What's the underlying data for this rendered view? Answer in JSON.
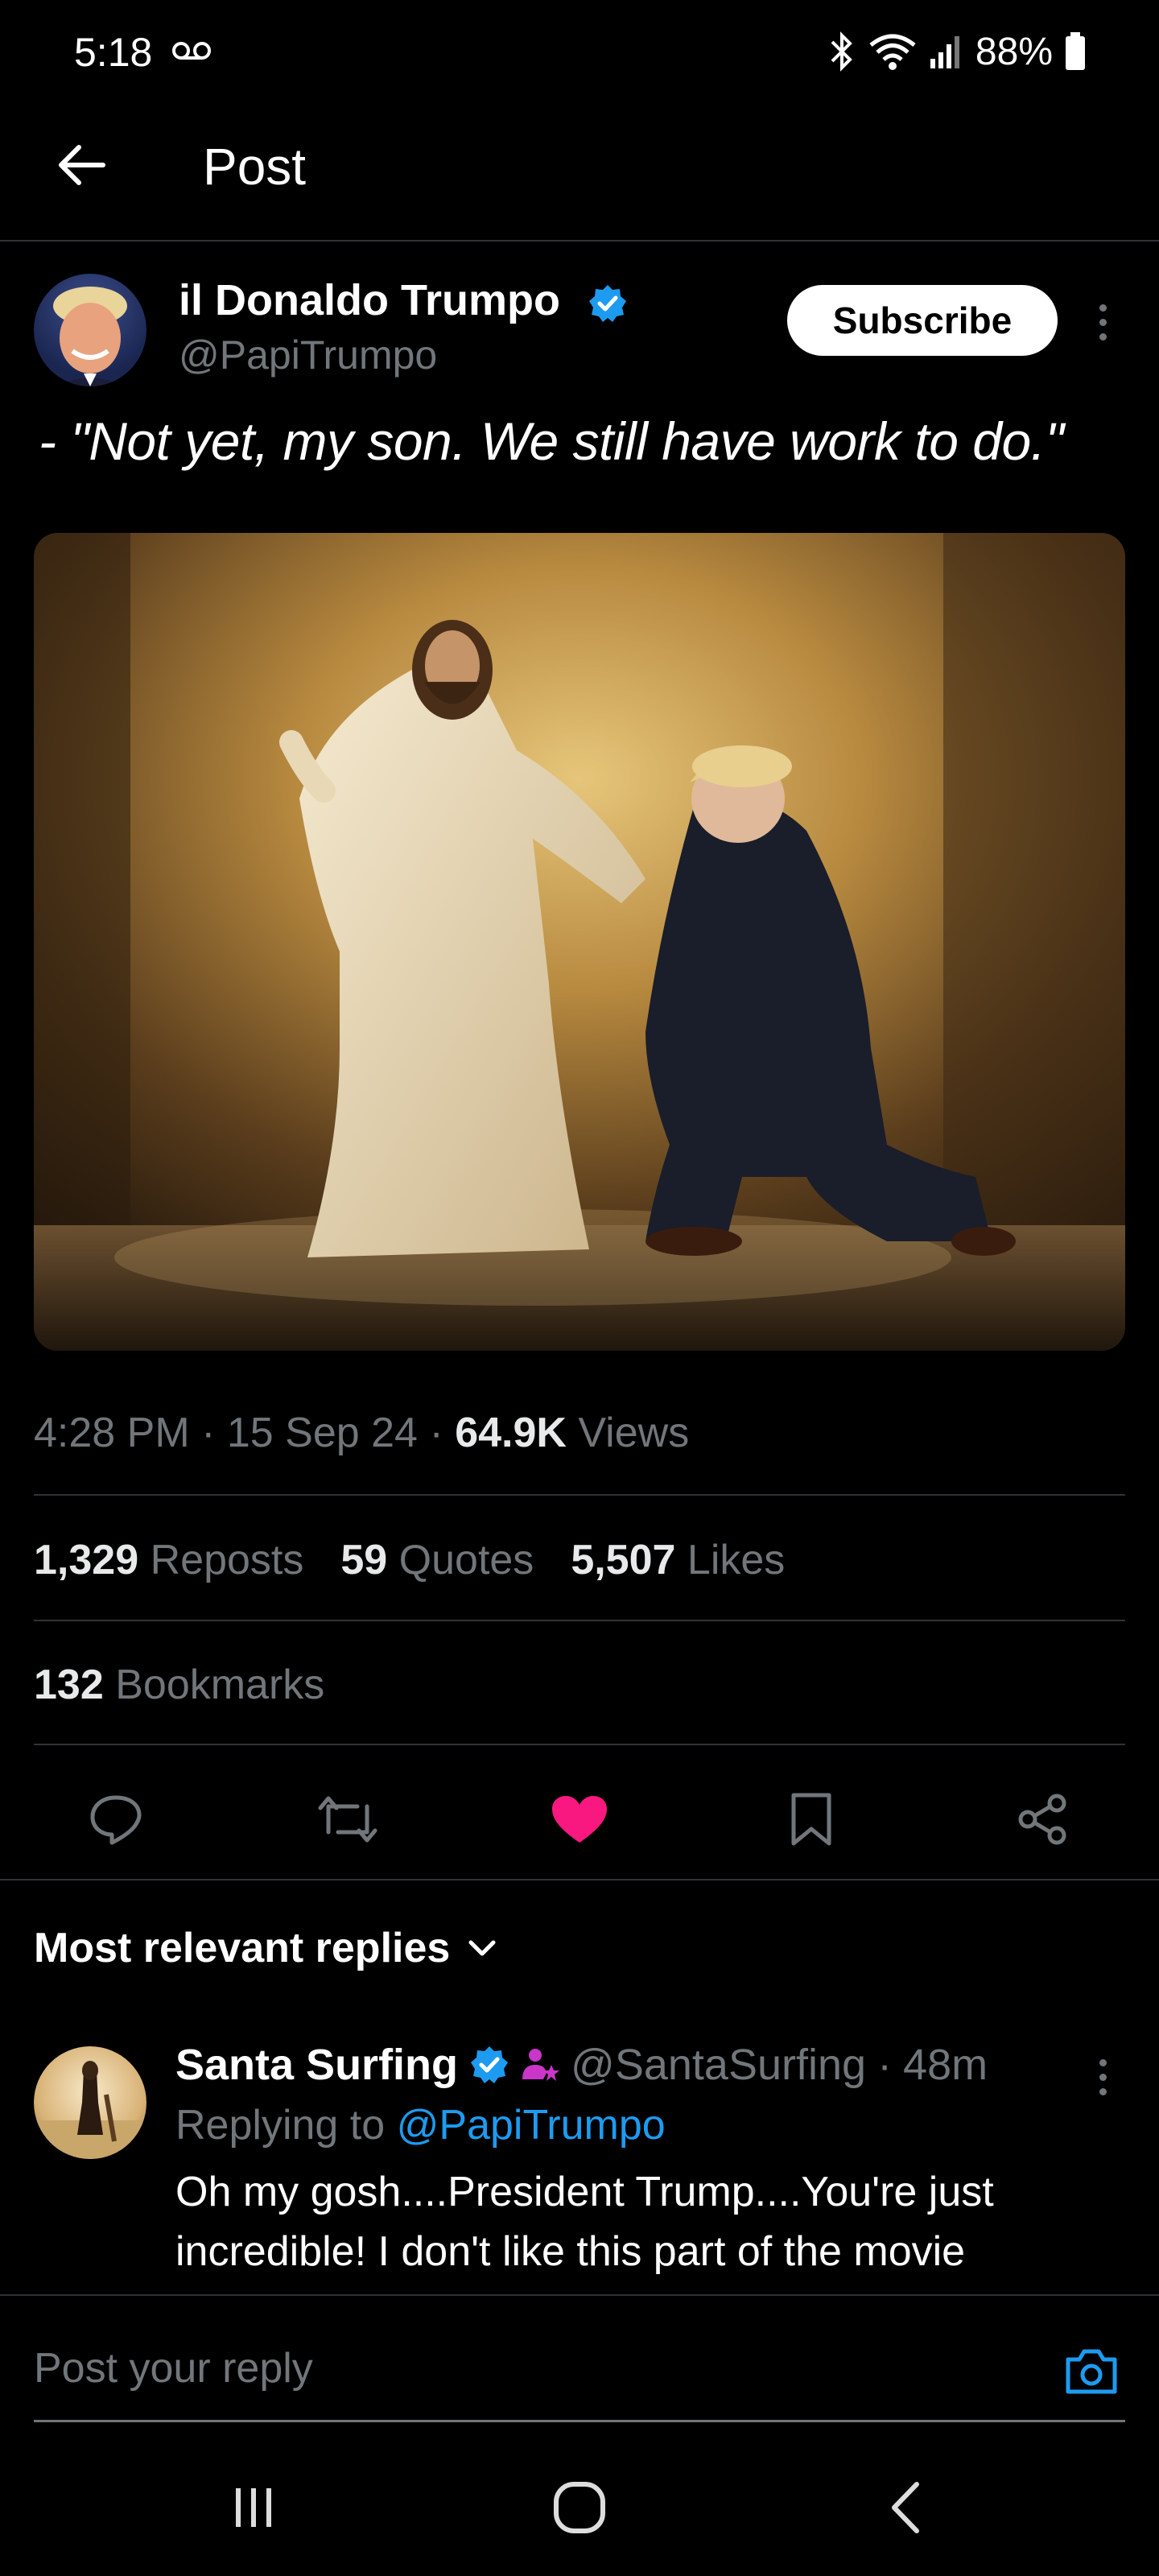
{
  "status_bar": {
    "time": "5:18",
    "battery": "88%"
  },
  "header": {
    "title": "Post"
  },
  "post": {
    "author_name": "il Donaldo Trumpo",
    "author_handle": "@PapiTrumpo",
    "subscribe_label": "Subscribe",
    "text": "- \"Not yet, my son. We still have work to do.\"",
    "time": "4:28 PM",
    "date": "15 Sep 24",
    "views_count": "64.9K",
    "views_label": "Views",
    "reposts_count": "1,329",
    "reposts_label": "Reposts",
    "quotes_count": "59",
    "quotes_label": "Quotes",
    "likes_count": "5,507",
    "likes_label": "Likes",
    "bookmarks_count": "132",
    "bookmarks_label": "Bookmarks",
    "liked": true
  },
  "replies": {
    "sort_label": "Most relevant replies",
    "items": [
      {
        "author_name": "Santa Surfing",
        "author_handle": "@SantaSurfing",
        "time_ago": "48m",
        "replying_prefix": "Replying to",
        "replying_handle": "@PapiTrumpo",
        "text": "Oh my gosh....President Trump....You're just incredible!  I don't like this part of the movie"
      }
    ]
  },
  "composer": {
    "placeholder": "Post your reply"
  },
  "colors": {
    "accent": "#1d9bf0",
    "like": "#f91880",
    "background": "#000000",
    "muted_text": "#71767b"
  },
  "icons": [
    "back-arrow-icon",
    "verified-badge-icon",
    "more-vertical-icon",
    "reply-icon",
    "repost-icon",
    "like-icon",
    "bookmark-icon",
    "share-icon",
    "chevron-down-icon",
    "camera-icon",
    "subscriber-icon"
  ]
}
